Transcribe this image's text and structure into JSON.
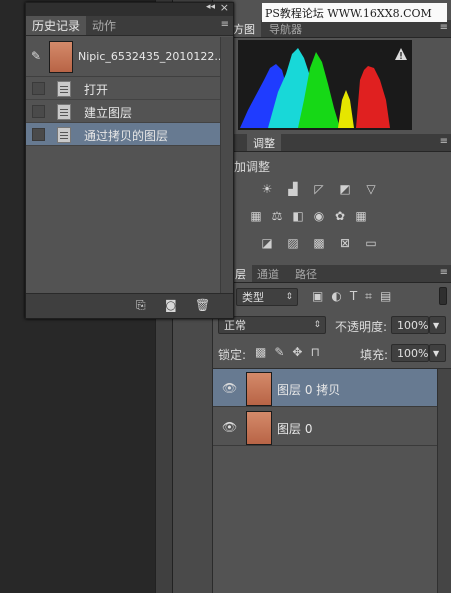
{
  "watermark": "PS教程论坛 WWW.16XX8.COM",
  "histogram_panel": {
    "tab_partial": "方图",
    "tab_navigator": "导航器"
  },
  "adjustments_panel": {
    "tab": "调整",
    "title_partial": "加调整"
  },
  "layers_panel": {
    "tabs": [
      "层",
      "通道",
      "路径"
    ],
    "filter_kind": "类型",
    "blend_mode": "正常",
    "opacity_label": "不透明度:",
    "opacity_value": "100%",
    "lock_label": "锁定:",
    "fill_label": "填充:",
    "fill_value": "100%",
    "layers": [
      {
        "name": "图层 0 拷贝",
        "selected": true
      },
      {
        "name": "图层 0",
        "selected": false
      }
    ]
  },
  "history_panel": {
    "tabs": [
      "历史记录",
      "动作"
    ],
    "snapshot_name": "Nipic_6532435_2010122...",
    "items": [
      {
        "label": "打开",
        "selected": false
      },
      {
        "label": "建立图层",
        "selected": false
      },
      {
        "label": "通过拷贝的图层",
        "selected": true
      }
    ]
  },
  "colors": {
    "selection": "#677a91",
    "panel": "#535353",
    "canvas": "#282828"
  }
}
